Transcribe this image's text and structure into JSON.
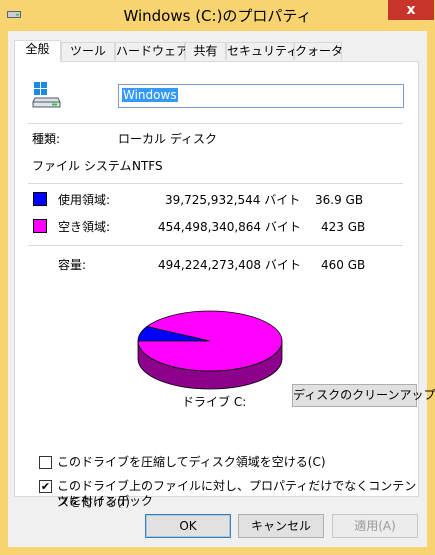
{
  "window": {
    "title": "Windows (C:)のプロパティ",
    "close_glyph": "x"
  },
  "tabs": [
    {
      "label": "全般",
      "active": true
    },
    {
      "label": "ツール",
      "active": false
    },
    {
      "label": "ハードウェア",
      "active": false
    },
    {
      "label": "共有",
      "active": false
    },
    {
      "label": "セキュリティ",
      "active": false
    },
    {
      "label": "クォータ",
      "active": false
    }
  ],
  "general": {
    "drive_name": "Windows",
    "type_label": "種類:",
    "type_value": "ローカル ディスク",
    "fs_label": "ファイル システム:",
    "fs_value": "NTFS",
    "used": {
      "label": "使用領域:",
      "bytes": "39,725,932,544 バイト",
      "size": "36.9 GB",
      "color": "#0000ff"
    },
    "free": {
      "label": "空き領域:",
      "bytes": "454,498,340,864 バイト",
      "size": "423 GB",
      "color": "#ff00ff"
    },
    "capacity": {
      "label": "容量:",
      "bytes": "494,224,273,408 バイト",
      "size": "460 GB"
    },
    "drive_label": "ドライブ C:",
    "cleanup_button": "ディスクのクリーンアップ(D)",
    "compress_option": {
      "label": "このドライブを圧縮してディスク領域を空ける(C)",
      "checked": false
    },
    "index_option": {
      "label_line1": "このドライブ上のファイルに対し、プロパティだけでなくコンテンツにもインデック",
      "label_line2": "スを付ける(I)",
      "checked": true
    }
  },
  "chart_data": {
    "type": "pie",
    "categories": [
      "使用領域",
      "空き領域"
    ],
    "values": [
      39725932544,
      454498340864
    ],
    "colors": [
      "#0000ff",
      "#ff00ff"
    ]
  },
  "buttons": {
    "ok": "OK",
    "cancel": "キャンセル",
    "apply": "適用(A)"
  }
}
